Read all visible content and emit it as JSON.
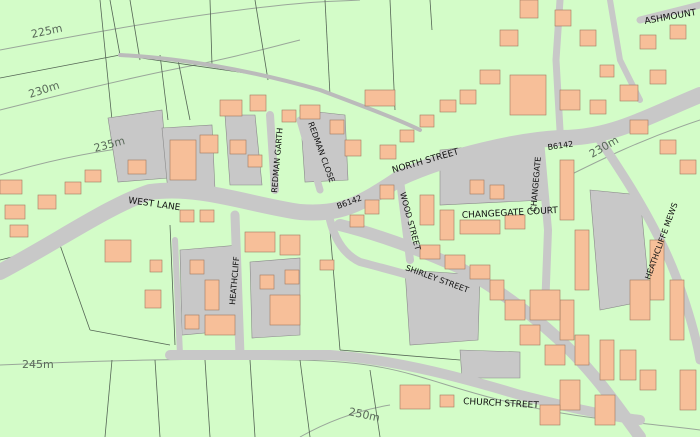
{
  "map": {
    "background_color": "#d3fcc8",
    "road_color": "#c8c8c8",
    "building_color": "#f7bf99",
    "paved_color": "#c8c8c8",
    "contour_color": "#9aa79a",
    "field_line_color": "#556655"
  },
  "street_labels": {
    "west_lane": "WEST LANE",
    "north_street": "NORTH STREET",
    "b6142_west": "B6142",
    "b6142_east": "B6142",
    "b6142_ne": "B6142",
    "redman_garth": "REDMAN GARTH",
    "redman_close": "REDMAN CLOSE",
    "wood_street": "WOOD STREET",
    "heathcliff": "HEATHCLIFF",
    "shirley_street": "SHIRLEY STREET",
    "changegate_court": "CHANGEGATE COURT",
    "changegate": "CHANGEGATE",
    "church_street": "CHURCH STREET",
    "ashmount": "ASHMOUNT",
    "heathcliffe_mews": "HEATHCLIFFE MEWS"
  },
  "contour_labels": {
    "c225": "225m",
    "c230": "230m",
    "c235": "235m",
    "c245": "245m",
    "c250": "250m",
    "c230_east": "230m"
  }
}
